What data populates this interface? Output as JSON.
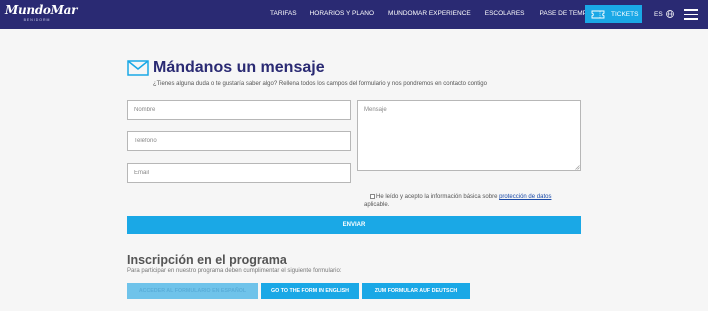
{
  "header": {
    "logo_text": "MundoMar",
    "logo_sub": "BENIDORM",
    "nav": [
      "TARIFAS",
      "HORARIOS Y PLANO",
      "MUNDOMAR EXPERIENCE",
      "ESCOLARES",
      "PASE DE TEMPORADA"
    ],
    "tickets_label": "TICKETS",
    "tickets_icon": "ticket-icon",
    "lang_label": "ES",
    "lang_icon": "globe-icon",
    "menu_icon": "hamburger-menu-icon"
  },
  "contact": {
    "icon": "envelope-icon",
    "title": "Mándanos un mensaje",
    "subtitle": "¿Tienes alguna duda o te gustaría saber algo? Rellena todos los campos del formulario y nos pondremos en contacto contigo",
    "fields": {
      "name_placeholder": "Nombre",
      "phone_placeholder": "Teléfono",
      "email_placeholder": "Email",
      "message_placeholder": "Mensaje",
      "name_value": "",
      "phone_value": "",
      "email_value": "",
      "message_value": ""
    },
    "consent_text": "He leído y acepto la información básica sobre ",
    "consent_link": "protección de datos",
    "consent_text_2": "aplicable.",
    "consent_checked": false,
    "send_label": "ENVIAR"
  },
  "program": {
    "title": "Inscripción en el programa",
    "subtitle": "Para participar en nuestro programa deben cumplimentar el siguiente formulario:",
    "buttons": [
      "ACCEDER AL FORMULARIO EN ESPAÑOL",
      "GO TO THE FORM IN ENGLISH",
      "ZUM FORMULAR AUF DEUTSCH"
    ]
  },
  "colors": {
    "header_bg": "#2a2a73",
    "accent": "#1aa8e6",
    "title": "#2a2a73",
    "page_bg": "#f6f6f6"
  }
}
